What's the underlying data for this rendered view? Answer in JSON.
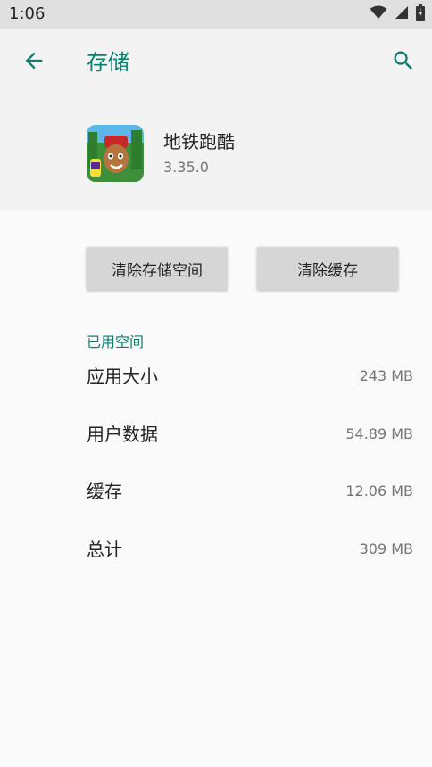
{
  "status_bar": {
    "time": "1:06",
    "icons": [
      "wifi-icon",
      "cell-signal-icon",
      "battery-icon"
    ]
  },
  "header": {
    "title": "存储",
    "back_icon": "arrow-left-icon",
    "search_icon": "search-icon"
  },
  "app": {
    "name": "地铁跑酷",
    "version": "3.35.0",
    "icon": "app-icon"
  },
  "buttons": {
    "clear_storage": "清除存储空间",
    "clear_cache": "清除缓存"
  },
  "usage": {
    "section_title": "已用空间",
    "rows": [
      {
        "label": "应用大小",
        "value": "243 MB"
      },
      {
        "label": "用户数据",
        "value": "54.89 MB"
      },
      {
        "label": "缓存",
        "value": "12.06 MB"
      },
      {
        "label": "总计",
        "value": "309 MB"
      }
    ]
  },
  "colors": {
    "accent": "#0b7d6e",
    "status_bar_bg": "#e0e0e0",
    "header_bg": "#f3f3f3",
    "page_bg": "#fafafa",
    "button_bg": "#d6d6d6"
  }
}
